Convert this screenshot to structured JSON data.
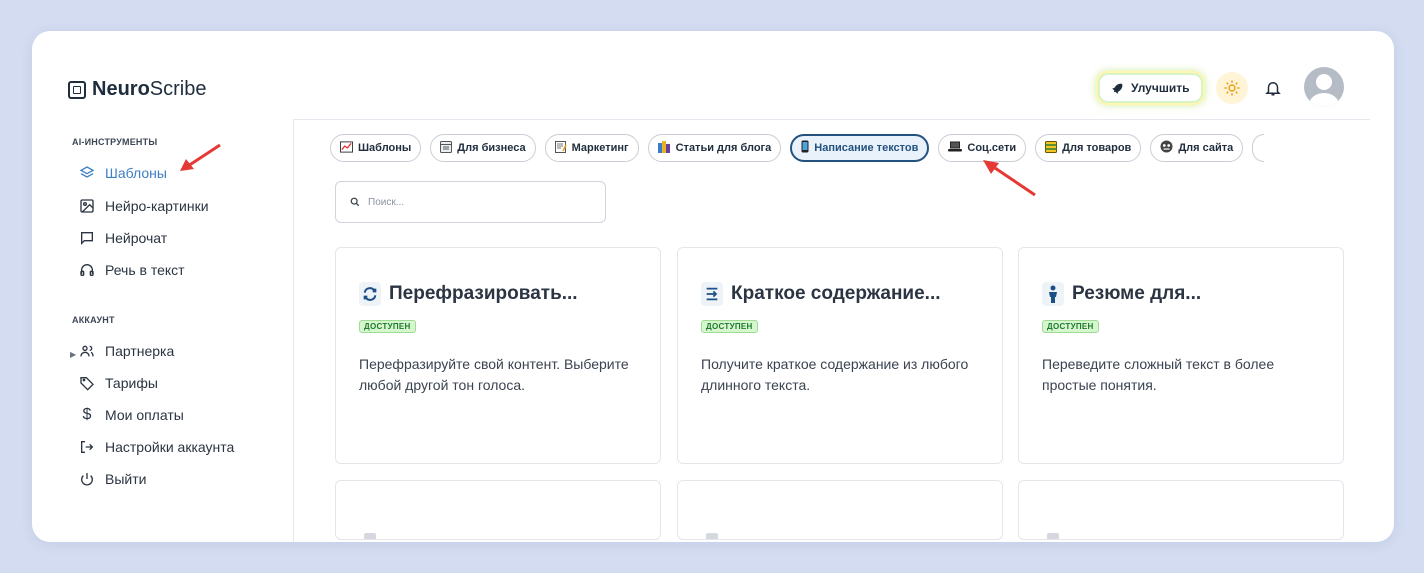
{
  "header": {
    "logo_bold": "Neuro",
    "logo_rest": "Scribe",
    "upgrade_label": "Улучшить"
  },
  "sidebar": {
    "sections": [
      {
        "label": "AI-ИНСТРУМЕНТЫ",
        "items": [
          {
            "label": "Шаблоны",
            "icon": "layers-icon",
            "active": true
          },
          {
            "label": "Нейро-картинки",
            "icon": "image-icon"
          },
          {
            "label": "Нейрочат",
            "icon": "chat-icon"
          },
          {
            "label": "Речь в текст",
            "icon": "headphones-icon"
          }
        ]
      },
      {
        "label": "АККАУНТ",
        "items": [
          {
            "label": "Партнерка",
            "icon": "users-icon"
          },
          {
            "label": "Тарифы",
            "icon": "tag-icon"
          },
          {
            "label": "Мои оплаты",
            "icon": "dollar-icon"
          },
          {
            "label": "Настройки аккаунта",
            "icon": "logout-arrow-icon"
          },
          {
            "label": "Выйти",
            "icon": "power-icon"
          }
        ]
      }
    ]
  },
  "categories": [
    {
      "label": "Шаблоны",
      "icon": "chart-icon"
    },
    {
      "label": "Для бизнеса",
      "icon": "calendar-icon"
    },
    {
      "label": "Маркетинг",
      "icon": "memo-icon"
    },
    {
      "label": "Статьи для блога",
      "icon": "books-icon"
    },
    {
      "label": "Написание текстов",
      "icon": "phone-icon",
      "active": true
    },
    {
      "label": "Соц.сети",
      "icon": "laptop-icon"
    },
    {
      "label": "Для товаров",
      "icon": "ledger-icon"
    },
    {
      "label": "Для сайта",
      "icon": "mask-icon"
    }
  ],
  "search": {
    "placeholder": "Поиск..."
  },
  "templates": [
    {
      "title": "Перефразировать...",
      "badge": "ДОСТУПЕН",
      "description": "Перефразируйте свой контент. Выберите любой другой тон голоса.",
      "icon": "refresh-icon"
    },
    {
      "title": "Краткое содержание...",
      "badge": "ДОСТУПЕН",
      "description": "Получите краткое содержание из любого длинного текста.",
      "icon": "compress-icon"
    },
    {
      "title": "Резюме для...",
      "badge": "ДОСТУПЕН",
      "description": "Переведите сложный текст в более простые понятия.",
      "icon": "person-icon"
    }
  ],
  "colors": {
    "accent": "#3f7fc4",
    "active_chip_border": "#24527f",
    "badge_bg": "#d6f6cf",
    "annotation_arrow": "#e53935"
  }
}
